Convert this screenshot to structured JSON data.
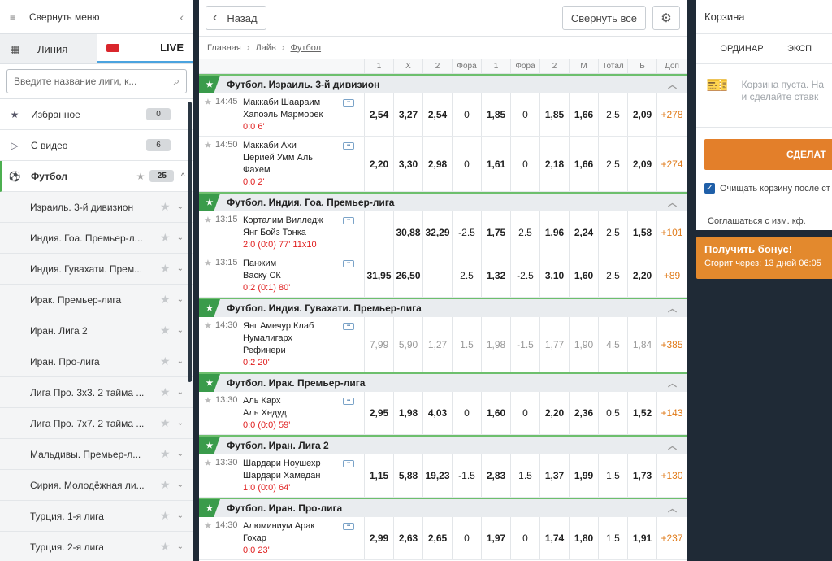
{
  "sidebar": {
    "collapse_label": "Свернуть меню",
    "tab_line": "Линия",
    "tab_live": "LIVE",
    "search_placeholder": "Введите название лиги, к...",
    "favorites": {
      "label": "Избранное",
      "count": "0"
    },
    "video": {
      "label": "С видео",
      "count": "6"
    },
    "football": {
      "label": "Футбол",
      "count": "25"
    },
    "leagues": [
      "Израиль. 3-й дивизион",
      "Индия. Гоа. Премьер-л...",
      "Индия. Гувахати. Прем...",
      "Ирак. Премьер-лига",
      "Иран. Лига 2",
      "Иран. Про-лига",
      "Лига Про. 3х3. 2 тайма ...",
      "Лига Про. 7х7. 2 тайма ...",
      "Мальдивы. Премьер-л...",
      "Сирия. Молодёжная ли...",
      "Турция. 1-я лига",
      "Турция. 2-я лига"
    ]
  },
  "main": {
    "back_label": "Назад",
    "collapse_all_label": "Свернуть все",
    "breadcrumb": [
      "Главная",
      "Лайв",
      "Футбол"
    ],
    "columns": [
      "1",
      "X",
      "2",
      "Фора",
      "1",
      "Фора",
      "2",
      "М",
      "Тотал",
      "Б",
      "Доп"
    ],
    "leagues": [
      {
        "title": "Футбол. Израиль. 3-й дивизион",
        "events": [
          {
            "time": "14:45",
            "names": [
              "Маккаби Шаараим",
              "Хапоэль Марморек"
            ],
            "score": "0:0 6'",
            "odds": [
              "2,54",
              "3,27",
              "2,54",
              "0",
              "1,85",
              "0",
              "1,85",
              "1,66",
              "2.5",
              "2,09",
              "+278"
            ],
            "light": false
          },
          {
            "time": "14:50",
            "names": [
              "Маккаби Ахи",
              "Церией Умм Аль",
              "Фахем"
            ],
            "score": "0:0 2'",
            "odds": [
              "2,20",
              "3,30",
              "2,98",
              "0",
              "1,61",
              "0",
              "2,18",
              "1,66",
              "2.5",
              "2,09",
              "+274"
            ],
            "light": false
          }
        ]
      },
      {
        "title": "Футбол. Индия. Гоа. Премьер-лига",
        "events": [
          {
            "time": "13:15",
            "names": [
              "Корталим Вилледж",
              "Янг Бойз Тонка"
            ],
            "score": "2:0 (0:0) 77' 11x10",
            "odds": [
              "",
              "30,88",
              "32,29",
              "-2.5",
              "1,75",
              "2.5",
              "1,96",
              "2,24",
              "2.5",
              "1,58",
              "+101"
            ],
            "light": false
          },
          {
            "time": "13:15",
            "names": [
              "Панжим",
              "Васку СК"
            ],
            "score": "0:2 (0:1) 80'",
            "odds": [
              "31,95",
              "26,50",
              "",
              "2.5",
              "1,32",
              "-2.5",
              "3,10",
              "1,60",
              "2.5",
              "2,20",
              "+89"
            ],
            "light": false
          }
        ]
      },
      {
        "title": "Футбол. Индия. Гувахати. Премьер-лига",
        "events": [
          {
            "time": "14:30",
            "names": [
              "Янг Амечур Клаб",
              "Нумалигарх",
              "Рефинери"
            ],
            "score": "0:2 20'",
            "odds": [
              "7,99",
              "5,90",
              "1,27",
              "1.5",
              "1,98",
              "-1.5",
              "1,77",
              "1,90",
              "4.5",
              "1,84",
              "+385"
            ],
            "light": true
          }
        ]
      },
      {
        "title": "Футбол. Ирак. Премьер-лига",
        "events": [
          {
            "time": "13:30",
            "names": [
              "Аль Карх",
              "Аль Хедуд"
            ],
            "score": "0:0 (0:0) 59'",
            "odds": [
              "2,95",
              "1,98",
              "4,03",
              "0",
              "1,60",
              "0",
              "2,20",
              "2,36",
              "0.5",
              "1,52",
              "+143"
            ],
            "light": false
          }
        ]
      },
      {
        "title": "Футбол. Иран. Лига 2",
        "events": [
          {
            "time": "13:30",
            "names": [
              "Шардари Ноушехр",
              "Шардари Хамедан"
            ],
            "score": "1:0 (0:0) 64'",
            "odds": [
              "1,15",
              "5,88",
              "19,23",
              "-1.5",
              "2,83",
              "1.5",
              "1,37",
              "1,99",
              "1.5",
              "1,73",
              "+130"
            ],
            "light": false
          }
        ]
      },
      {
        "title": "Футбол. Иран. Про-лига",
        "events": [
          {
            "time": "14:30",
            "names": [
              "Алюминиум Арак",
              "Гохар"
            ],
            "score": "0:0 23'",
            "odds": [
              "2,99",
              "2,63",
              "2,65",
              "0",
              "1,97",
              "0",
              "1,74",
              "1,80",
              "1.5",
              "1,91",
              "+237"
            ],
            "light": false
          }
        ]
      }
    ]
  },
  "coupon": {
    "title": "Корзина",
    "tab_single": "ОРДИНАР",
    "tab_express": "ЭКСП",
    "empty_line1": "Корзина пуста. На",
    "empty_line2": "и сделайте ставк",
    "bet_button": "СДЕЛАТ",
    "clear_label": "Очищать корзину после ст",
    "agree_label": "Соглашаться с изм. кф.",
    "bonus_title": "Получить бонус!",
    "bonus_sub": "Сгорит через: 13 дней 06:05"
  },
  "colors": {
    "accent_orange": "#e37f2a",
    "live_red": "#d9262c",
    "league_green": "#3a9b4b",
    "score_red": "#e02020"
  }
}
